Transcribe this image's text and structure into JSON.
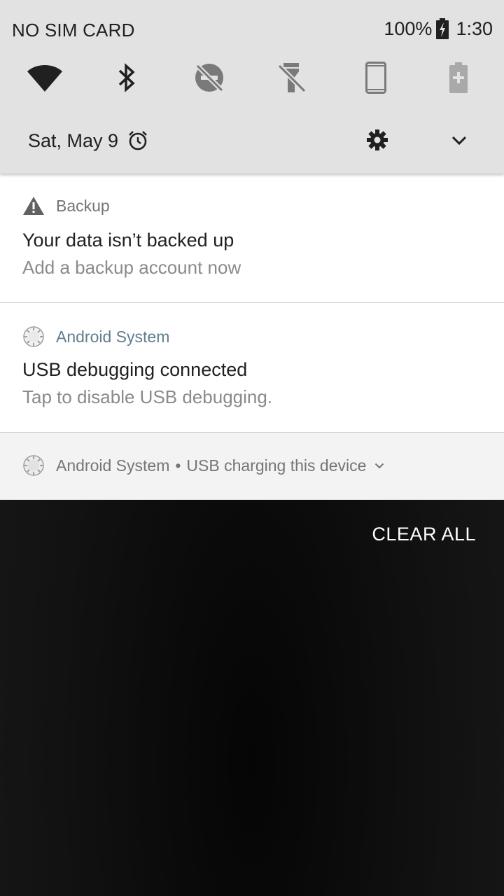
{
  "status_bar": {
    "carrier": "NO SIM CARD",
    "battery_percent": "100%",
    "battery_icon": "battery-charging-icon",
    "time": "1:30"
  },
  "quick_settings": {
    "tiles": [
      {
        "name": "wifi",
        "icon": "wifi-icon",
        "state": "on"
      },
      {
        "name": "bluetooth",
        "icon": "bluetooth-icon",
        "state": "on"
      },
      {
        "name": "do-not-disturb",
        "icon": "dnd-off-icon",
        "state": "off"
      },
      {
        "name": "flashlight",
        "icon": "flashlight-off-icon",
        "state": "off"
      },
      {
        "name": "auto-rotate",
        "icon": "phone-portrait-icon",
        "state": "off"
      },
      {
        "name": "battery-saver",
        "icon": "battery-saver-icon",
        "state": "disabled"
      }
    ],
    "date": "Sat, May 9",
    "settings_icon": "gear-icon",
    "expand_icon": "chevron-down-icon"
  },
  "notifications": [
    {
      "app": "Backup",
      "icon": "warning-icon",
      "title": "Your data isn’t backed up",
      "text": "Add a backup account now"
    },
    {
      "app": "Android System",
      "icon": "android-system-icon",
      "title": "USB debugging connected",
      "text": "Tap to disable USB debugging."
    },
    {
      "app": "Android System",
      "separator": "•",
      "summary": "USB charging this device",
      "icon": "android-system-icon"
    }
  ],
  "actions": {
    "clear_all": "CLEAR ALL"
  },
  "colors": {
    "shade_bg": "#e2e2e2",
    "notification_bg": "#ffffff",
    "collapsed_bg": "#f3f3f3",
    "accent_teal": "#607d8b",
    "background": "#121212"
  }
}
